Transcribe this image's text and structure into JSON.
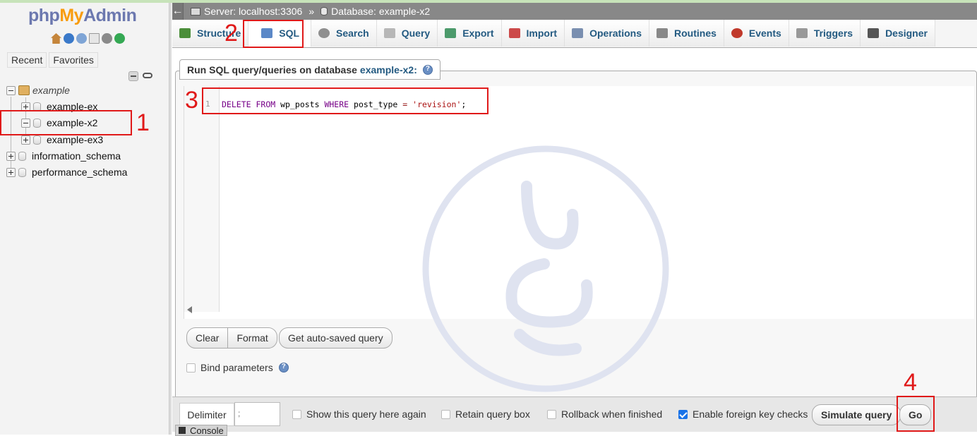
{
  "nav": {
    "logo": {
      "php": "php",
      "my": "My",
      "admin": "Admin"
    },
    "icons": [
      "home-icon",
      "exit-icon",
      "help-icon",
      "docs-icon",
      "settings-icon",
      "reload-icon"
    ],
    "recent_label": "Recent",
    "favorites_label": "Favorites",
    "tree": {
      "root": "example",
      "children": [
        "example-ex",
        "example-x2",
        "example-ex3"
      ],
      "others": [
        "information_schema",
        "performance_schema"
      ]
    }
  },
  "breadcrumb": {
    "server": "Server: localhost:3306",
    "separator": "»",
    "database": "Database: example-x2"
  },
  "tabs": [
    {
      "label": "Structure",
      "icon": "structure-icon",
      "color": "#4b8e3a"
    },
    {
      "label": "SQL",
      "icon": "sql-icon",
      "color": "#5b88c7"
    },
    {
      "label": "Search",
      "icon": "search-icon",
      "color": "#8f8f8f"
    },
    {
      "label": "Query",
      "icon": "query-icon",
      "color": "#b7b7b7"
    },
    {
      "label": "Export",
      "icon": "export-icon",
      "color": "#4c9a6b"
    },
    {
      "label": "Import",
      "icon": "import-icon",
      "color": "#cc4a4a"
    },
    {
      "label": "Operations",
      "icon": "wrench-icon",
      "color": "#7a8fb0"
    },
    {
      "label": "Routines",
      "icon": "routines-icon",
      "color": "#888888"
    },
    {
      "label": "Events",
      "icon": "clock-icon",
      "color": "#c0392b"
    },
    {
      "label": "Triggers",
      "icon": "triggers-icon",
      "color": "#999999"
    },
    {
      "label": "Designer",
      "icon": "designer-icon",
      "color": "#555555"
    }
  ],
  "sql_panel": {
    "heading": "Run SQL query/queries on database",
    "database": "example-x2:",
    "line_number": "1",
    "query": {
      "delete": "DELETE",
      "from": "FROM",
      "table": "wp_posts",
      "where": "WHERE",
      "column": "post_type",
      "op": "=",
      "value": "'revision'",
      "end": ";"
    }
  },
  "buttons": {
    "clear": "Clear",
    "format": "Format",
    "autosaved": "Get auto-saved query",
    "bind_params": "Bind parameters",
    "simulate": "Simulate query",
    "go": "Go"
  },
  "footer": {
    "delimiter_label": "Delimiter",
    "delimiter_value": ";",
    "options": [
      {
        "label": "Show this query here again",
        "checked": false
      },
      {
        "label": "Retain query box",
        "checked": false
      },
      {
        "label": "Rollback when finished",
        "checked": false
      },
      {
        "label": "Enable foreign key checks",
        "checked": true
      }
    ]
  },
  "console": "Console",
  "annotations": [
    "1",
    "2",
    "3",
    "4"
  ],
  "colors": {
    "annotation_red": "#e01919",
    "link_blue": "#235a81",
    "breadcrumb_bg": "#888888",
    "watermark": "#dfe3f0"
  }
}
